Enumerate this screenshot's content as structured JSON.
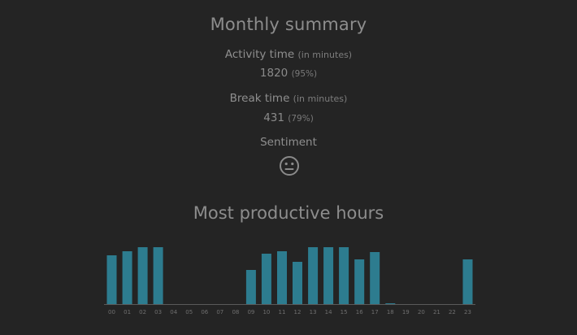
{
  "summary": {
    "title": "Monthly summary",
    "activity": {
      "label": "Activity time",
      "unit": "(in minutes)",
      "value": "1820",
      "percent": "(95%)"
    },
    "break": {
      "label": "Break time",
      "unit": "(in minutes)",
      "value": "431",
      "percent": "(79%)"
    },
    "sentiment": {
      "label": "Sentiment",
      "icon": "neutral-face-icon"
    }
  },
  "productive": {
    "title": "Most productive hours"
  },
  "colors": {
    "background": "#242424",
    "bar": "#2d7c8f",
    "text": "#8a8a8a"
  },
  "chart_data": {
    "type": "bar",
    "categories": [
      "00",
      "01",
      "02",
      "03",
      "04",
      "05",
      "06",
      "07",
      "08",
      "09",
      "10",
      "11",
      "12",
      "13",
      "14",
      "15",
      "16",
      "17",
      "18",
      "19",
      "20",
      "21",
      "22",
      "23"
    ],
    "values": [
      60,
      65,
      70,
      70,
      0,
      0,
      0,
      0,
      0,
      42,
      62,
      65,
      52,
      70,
      70,
      70,
      55,
      64,
      1,
      0,
      0,
      0,
      0,
      55
    ],
    "ylim": [
      0,
      70
    ],
    "grid": false,
    "legend": "none"
  }
}
